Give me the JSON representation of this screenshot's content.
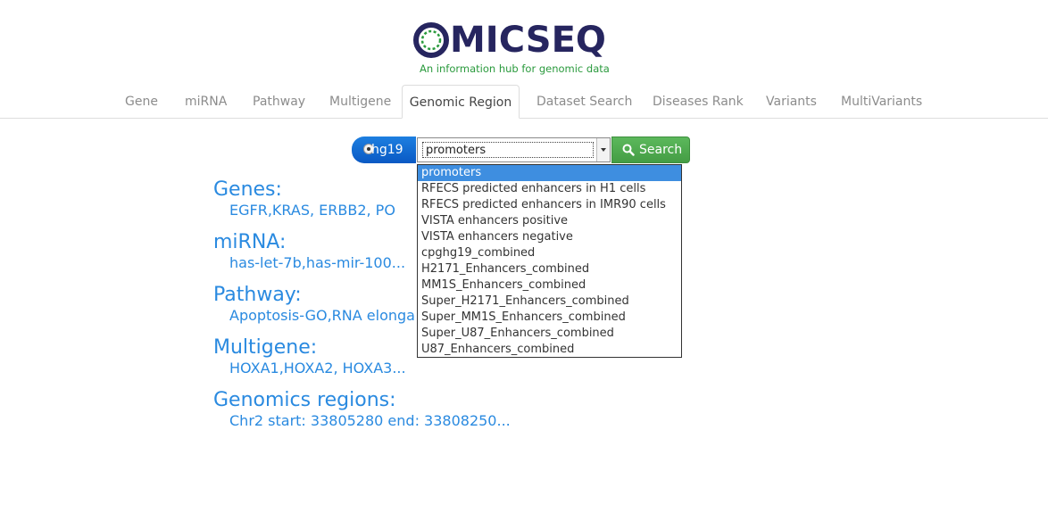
{
  "logo": {
    "wordmark": "MICSEQ",
    "tagline": "An information hub for genomic data",
    "brand_colors": {
      "wordmark": "#26255f",
      "tagline": "#2a9a3d"
    }
  },
  "tabs": [
    {
      "label": "Gene",
      "active": false
    },
    {
      "label": "miRNA",
      "active": false
    },
    {
      "label": "Pathway",
      "active": false
    },
    {
      "label": "Multigene",
      "active": false
    },
    {
      "label": "Genomic Region",
      "active": true
    },
    {
      "label": "Dataset Search",
      "active": false
    },
    {
      "label": "Diseases Rank",
      "active": false
    },
    {
      "label": "Variants",
      "active": false
    },
    {
      "label": "MultiVariants",
      "active": false
    }
  ],
  "search": {
    "genome_label": "hg19",
    "selected_region": "promoters",
    "button_label": "Search",
    "options": [
      "promoters",
      "RFECS predicted enhancers in H1 cells",
      "RFECS predicted enhancers in IMR90 cells",
      "VISTA enhancers positive",
      "VISTA enhancers negative",
      "cpghg19_combined",
      "H2171_Enhancers_combined",
      "MM1S_Enhancers_combined",
      "Super_H2171_Enhancers_combined",
      "Super_MM1S_Enhancers_combined",
      "Super_U87_Enhancers_combined",
      "U87_Enhancers_combined"
    ]
  },
  "examples": [
    {
      "heading": "Genes:",
      "value": "EGFR,KRAS, ERBB2, PO"
    },
    {
      "heading": "miRNA:",
      "value": "has-let-7b,has-mir-100..."
    },
    {
      "heading": "Pathway:",
      "value": "Apoptosis-GO,RNA elonga"
    },
    {
      "heading": "Multigene:",
      "value": "HOXA1,HOXA2, HOXA3..."
    },
    {
      "heading": "Genomics regions:",
      "value": "Chr2 start: 33805280 end: 33808250..."
    }
  ],
  "colors": {
    "link_blue": "#2a8ae0",
    "genome_pill": "#0a59c4",
    "search_green": "#5cb85c",
    "dropdown_highlight": "#3e8ee0"
  },
  "icons": {
    "search_button": "magnifier-icon",
    "genome_radio": "radio-icon"
  }
}
